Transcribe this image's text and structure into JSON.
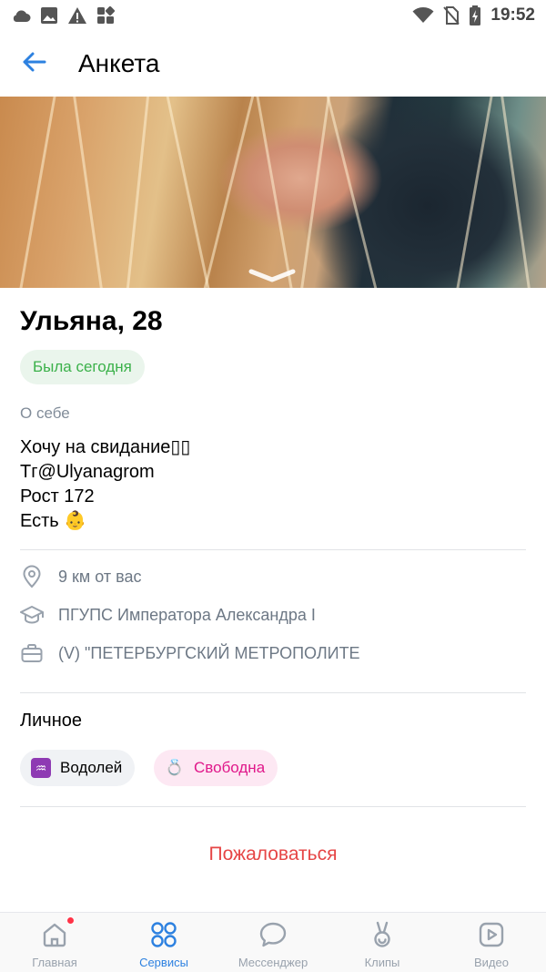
{
  "status_bar": {
    "time": "19:52",
    "left_icons": [
      "cloud-icon",
      "image-icon",
      "warning-icon",
      "apps-icon"
    ],
    "right_icons": [
      "wifi-icon",
      "no-sim-icon",
      "battery-charging-icon"
    ]
  },
  "header": {
    "title": "Анкета",
    "back_icon": "arrow-left-icon"
  },
  "profile": {
    "name_age": "Ульяна, 28",
    "online_status": "Была сегодня",
    "about_label": "О себе",
    "about_lines": [
      "Хочу на свидание▯▯",
      "Тг@Ulyanagrom",
      "Рост 172",
      "Есть 👶"
    ],
    "info": [
      {
        "icon": "location-pin-icon",
        "text": "9 км от вас"
      },
      {
        "icon": "graduation-cap-icon",
        "text": "ПГУПС Императора Александра I"
      },
      {
        "icon": "briefcase-icon",
        "text": "(V) \"ПЕТЕРБУРГСКИЙ МЕТРОПОЛИТЕ"
      }
    ],
    "personal_title": "Личное",
    "chips": [
      {
        "icon": "aquarius-icon",
        "glyph": "♒",
        "label": "Водолей"
      },
      {
        "icon": "ring-icon",
        "glyph": "💍",
        "label": "Свободна"
      }
    ],
    "report_label": "Пожаловаться"
  },
  "bottom_nav": [
    {
      "icon": "home-icon",
      "label": "Главная",
      "active": false,
      "badge_dot": true
    },
    {
      "icon": "services-icon",
      "label": "Сервисы",
      "active": true,
      "badge_dot": false
    },
    {
      "icon": "messenger-icon",
      "label": "Мессенджер",
      "active": false,
      "badge_dot": false
    },
    {
      "icon": "clips-icon",
      "label": "Клипы",
      "active": false,
      "badge_dot": false
    },
    {
      "icon": "video-icon",
      "label": "Видео",
      "active": false,
      "badge_dot": false
    }
  ],
  "colors": {
    "accent": "#2d81e0",
    "online_green": "#3bb14a",
    "report_red": "#e64646",
    "relationship_pink": "#e0188a",
    "secondary_text": "#6d7885"
  }
}
